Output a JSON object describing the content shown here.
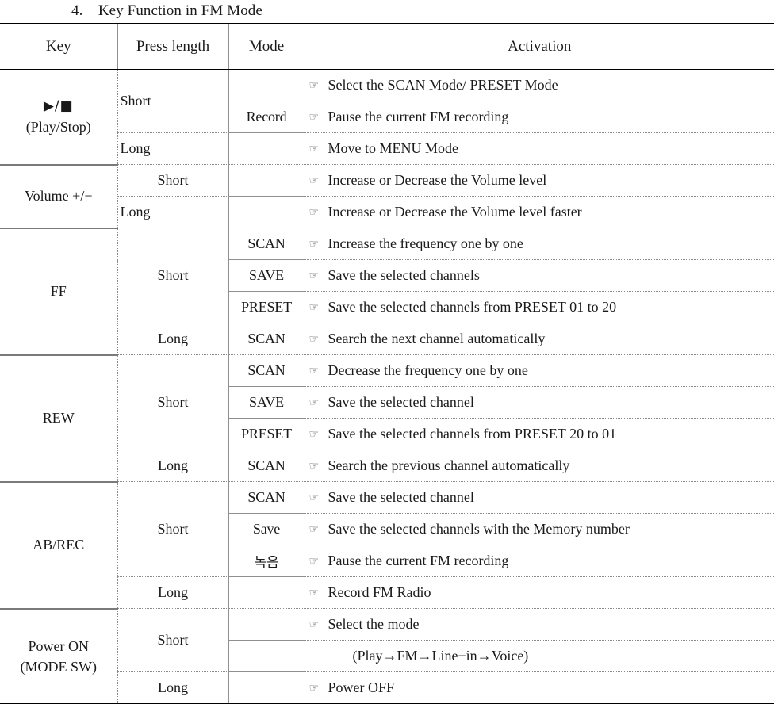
{
  "document": {
    "section_number": "4.",
    "title": "Key Function in FM Mode",
    "heading_full": "4.    Key Function in FM Mode"
  },
  "icons": {
    "bullet_hand": "☞",
    "play": "▶",
    "stop": "■"
  },
  "table": {
    "headers": {
      "key": "Key",
      "press_length": "Press length",
      "mode": "Mode",
      "activation": "Activation"
    },
    "groups": [
      {
        "key_symbol": "▶/■",
        "key_label": "(Play/Stop)",
        "rows": [
          {
            "press": "Short",
            "press_align": "left",
            "mode": "",
            "activation": "Select the SCAN Mode/ PRESET Mode",
            "bullet": true
          },
          {
            "press": "",
            "press_align": "left",
            "mode": "Record",
            "activation": "Pause the current FM recording",
            "bullet": true
          },
          {
            "press": "Long",
            "press_align": "left",
            "mode": "",
            "activation": "Move to MENU Mode",
            "bullet": true
          }
        ]
      },
      {
        "key_symbol": "Volume +/−",
        "key_label": "",
        "rows": [
          {
            "press": "Short",
            "press_align": "center",
            "mode": "",
            "activation": "Increase or Decrease the Volume level",
            "bullet": true
          },
          {
            "press": "Long",
            "press_align": "left",
            "mode": "",
            "activation": "Increase or Decrease the Volume level faster",
            "bullet": true
          }
        ]
      },
      {
        "key_symbol": "FF",
        "key_label": "",
        "rows": [
          {
            "press": "Short",
            "press_align": "center",
            "mode": "SCAN",
            "activation": "Increase the frequency one by one",
            "bullet": true
          },
          {
            "press": "",
            "press_align": "center",
            "mode": "SAVE",
            "activation": "Save the selected channels",
            "bullet": true
          },
          {
            "press": "",
            "press_align": "center",
            "mode": "PRESET",
            "activation": "Save the selected channels from PRESET 01 to 20",
            "bullet": true
          },
          {
            "press": "Long",
            "press_align": "center",
            "mode": "SCAN",
            "activation": "Search the next channel automatically",
            "bullet": true
          }
        ]
      },
      {
        "key_symbol": "REW",
        "key_label": "",
        "rows": [
          {
            "press": "Short",
            "press_align": "center",
            "mode": "SCAN",
            "activation": "Decrease the frequency one by one",
            "bullet": true
          },
          {
            "press": "",
            "press_align": "center",
            "mode": "SAVE",
            "activation": "Save the selected channel",
            "bullet": true
          },
          {
            "press": "",
            "press_align": "center",
            "mode": "PRESET",
            "activation": "Save the selected channels from PRESET 20 to 01",
            "bullet": true
          },
          {
            "press": "Long",
            "press_align": "center",
            "mode": "SCAN",
            "activation": "Search the previous channel automatically",
            "bullet": true
          }
        ]
      },
      {
        "key_symbol": "AB/REC",
        "key_label": "",
        "rows": [
          {
            "press": "Short",
            "press_align": "center",
            "mode": "SCAN",
            "activation": "Save the selected channel",
            "bullet": true
          },
          {
            "press": "",
            "press_align": "center",
            "mode": "Save",
            "activation": "Save the selected channels with the Memory number",
            "bullet": true
          },
          {
            "press": "",
            "press_align": "center",
            "mode": "녹음",
            "activation": "Pause the current FM recording",
            "bullet": true
          },
          {
            "press": "Long",
            "press_align": "center",
            "mode": "",
            "activation": "Record FM Radio",
            "bullet": true
          }
        ]
      },
      {
        "key_symbol": "Power ON",
        "key_label": "(MODE SW)",
        "rows": [
          {
            "press": "Short",
            "press_align": "center",
            "mode": "",
            "activation": "Select the mode",
            "bullet": true
          },
          {
            "press": "",
            "press_align": "center",
            "mode": "",
            "activation": "(Play→FM→Line−in→Voice)",
            "bullet": false
          },
          {
            "press": "Long",
            "press_align": "center",
            "mode": "",
            "activation": "Power OFF",
            "bullet": true
          }
        ]
      }
    ]
  }
}
